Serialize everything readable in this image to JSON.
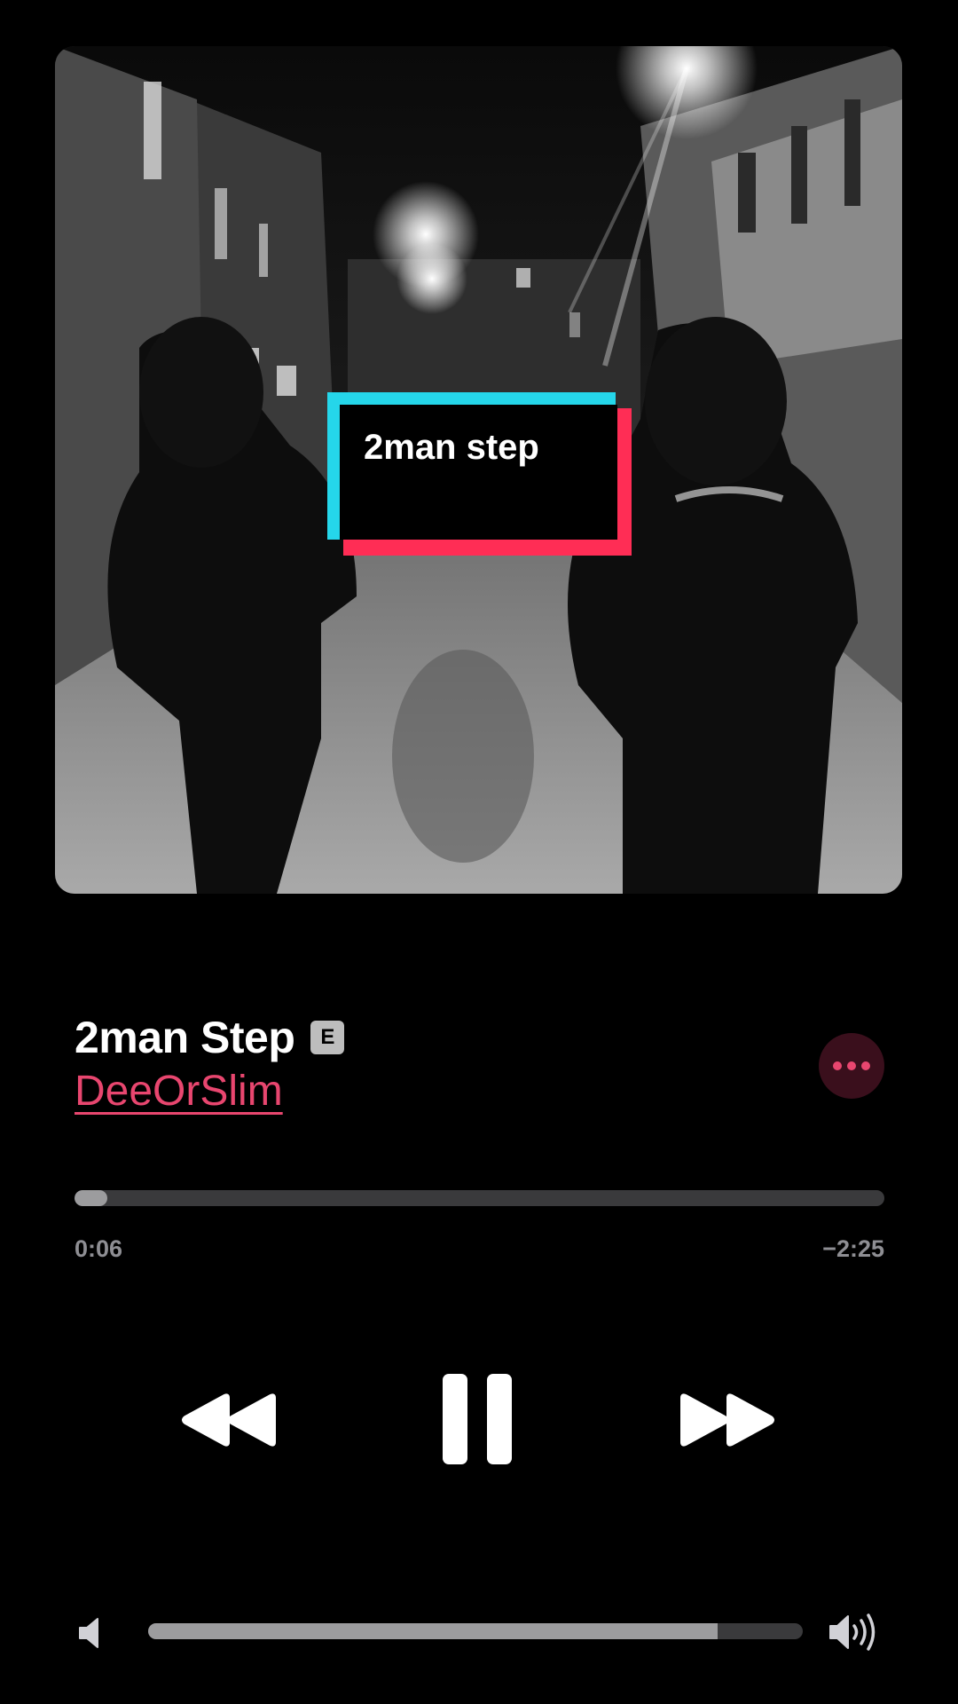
{
  "artwork": {
    "overlay_label": "2man step"
  },
  "track": {
    "title": "2man Step",
    "explicit_badge": "E",
    "artist": "DeeOrSlim"
  },
  "playback": {
    "elapsed": "0:06",
    "remaining": "−2:25",
    "progress_fraction": 0.04,
    "state": "playing"
  },
  "volume": {
    "level_fraction": 0.87
  },
  "icons": {
    "more": "ellipsis-icon",
    "rewind": "rewind-icon",
    "pause": "pause-icon",
    "forward": "fast-forward-icon",
    "volume_min": "speaker-low-icon",
    "volume_max": "speaker-high-icon"
  },
  "colors": {
    "accent": "#e8466f",
    "background": "#000000",
    "label_cyan": "#25d6ea",
    "label_pink": "#ff2d55"
  }
}
